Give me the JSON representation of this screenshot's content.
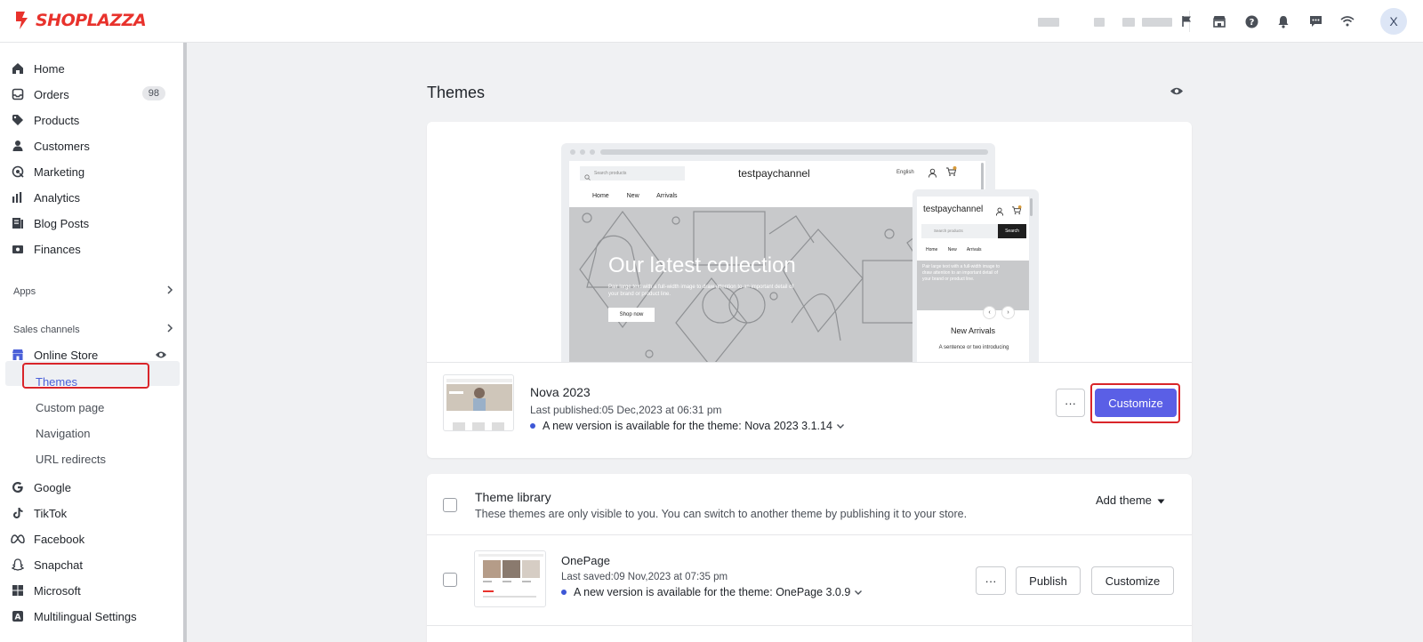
{
  "brand": {
    "name": "SHOPLAZZA",
    "color": "#e8322c"
  },
  "topbar": {
    "icons": [
      "flag-icon",
      "store-icon",
      "help-icon",
      "bell-icon",
      "chat-icon",
      "wifi-icon"
    ],
    "avatar_initial": "X"
  },
  "sidebar": {
    "items": [
      {
        "label": "Home",
        "icon": "home-icon"
      },
      {
        "label": "Orders",
        "icon": "orders-icon",
        "badge": "98"
      },
      {
        "label": "Products",
        "icon": "tag-icon"
      },
      {
        "label": "Customers",
        "icon": "person-icon"
      },
      {
        "label": "Marketing",
        "icon": "marketing-icon"
      },
      {
        "label": "Analytics",
        "icon": "analytics-icon"
      },
      {
        "label": "Blog Posts",
        "icon": "blog-icon"
      },
      {
        "label": "Finances",
        "icon": "finance-icon"
      }
    ],
    "apps_label": "Apps",
    "sales_channels_label": "Sales channels",
    "online_store_label": "Online Store",
    "online_store_sub": [
      "Themes",
      "Custom page",
      "Navigation",
      "URL redirects"
    ],
    "channels": [
      {
        "label": "Google",
        "icon": "google-icon"
      },
      {
        "label": "TikTok",
        "icon": "tiktok-icon"
      },
      {
        "label": "Facebook",
        "icon": "meta-icon"
      },
      {
        "label": "Snapchat",
        "icon": "ghost-icon"
      },
      {
        "label": "Microsoft",
        "icon": "grid-icon"
      },
      {
        "label": "Multilingual Settings",
        "icon": "translate-icon"
      }
    ]
  },
  "main": {
    "title": "Themes",
    "preview": {
      "store_name": "testpaychannel",
      "search_placeholder": "Search products",
      "language": "English",
      "nav": "Home New Arrivals",
      "hero_title": "Our latest collection",
      "hero_subtitle": "Pair large text with a full-width image to draw attention to an important detail of your brand or product line.",
      "hero_button": "Shop now",
      "mobile_search_button": "Search",
      "mobile_nav": "Home New Arrivals",
      "mobile_section_title": "New Arrivals",
      "mobile_section_text": "A sentence or two introducing"
    },
    "current_theme": {
      "name": "Nova 2023",
      "published": "Last published:05 Dec,2023 at 06:31 pm",
      "version_notice": "A new version is available for the theme: Nova 2023 3.1.14",
      "more_label": "···",
      "customize_label": "Customize"
    },
    "library": {
      "title": "Theme library",
      "description": "These themes are only visible to you. You can switch to another theme by publishing it to your store.",
      "add_theme_label": "Add theme",
      "themes": [
        {
          "name": "OnePage",
          "saved": "Last saved:09 Nov,2023 at 07:35 pm",
          "version_notice": "A new version is available for the theme: OnePage 3.0.9",
          "more_label": "···",
          "publish_label": "Publish",
          "customize_label": "Customize"
        }
      ]
    }
  }
}
